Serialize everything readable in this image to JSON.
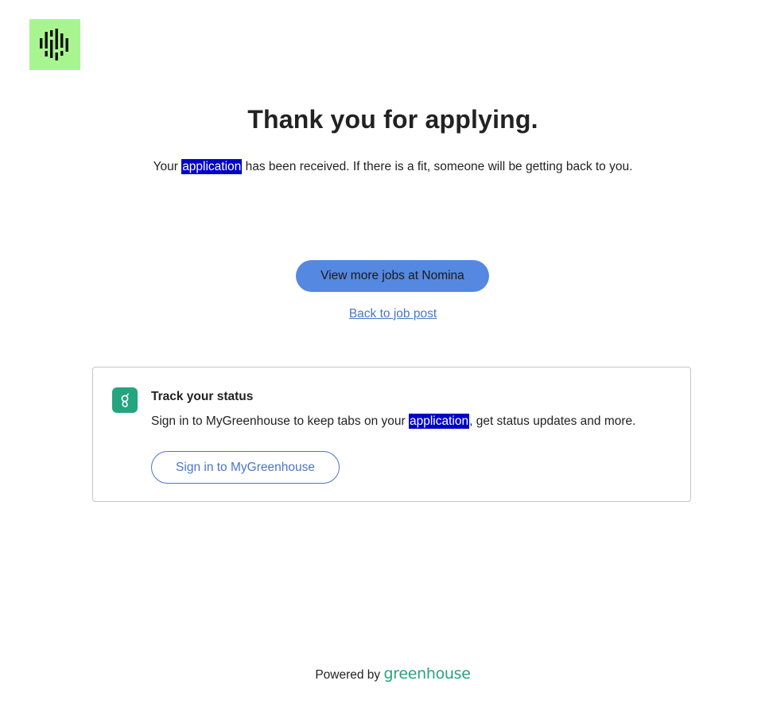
{
  "header": {
    "logo_icon": "sound-wave-bars-icon",
    "logo_bg": "#a8f590"
  },
  "main": {
    "title": "Thank you for applying.",
    "received": {
      "before": "Your ",
      "highlighted": "application",
      "after": " has been received. If there is a fit, someone will be getting back to you."
    },
    "view_jobs_label": "View more jobs at Nomina",
    "back_link_label": "Back to job post"
  },
  "track_card": {
    "icon": "greenhouse-g-icon",
    "title": "Track your status",
    "text": {
      "before": "Sign in to MyGreenhouse to keep tabs on your ",
      "highlighted": "application",
      "after": ", get status updates and more."
    },
    "signin_label": "Sign in to MyGreenhouse"
  },
  "footer": {
    "powered_by": "Powered by",
    "brand": "greenhouse"
  },
  "colors": {
    "accent_blue": "#5588e0",
    "link_blue": "#4a76c8",
    "greenhouse_green": "#24a47f",
    "highlight": "#0000cc"
  }
}
